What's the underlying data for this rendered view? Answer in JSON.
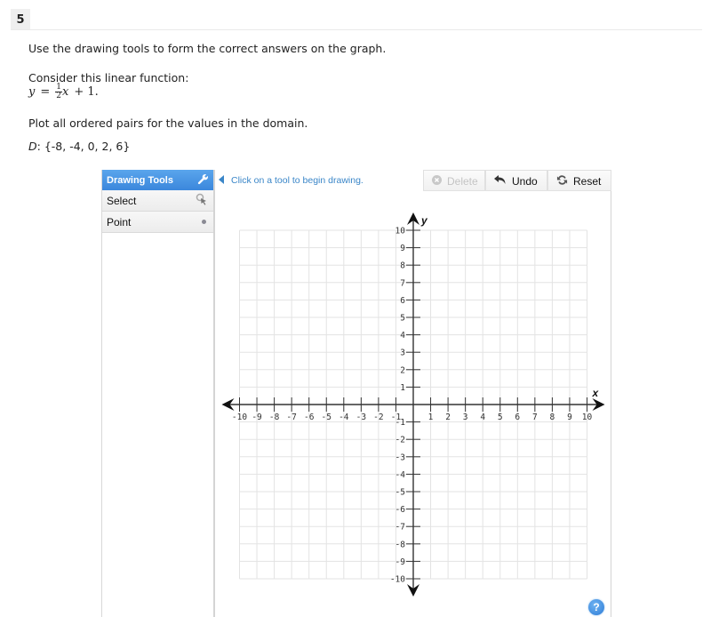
{
  "question": {
    "number": "5",
    "instruction": "Use the drawing tools to form the correct answers on the graph.",
    "consider": "Consider this linear function:",
    "equation": {
      "lhs": "y",
      "equals": "=",
      "frac_num": "1",
      "frac_den": "2",
      "var": "x",
      "rest": "+ 1."
    },
    "plot_prompt": "Plot all ordered pairs for the values in the domain.",
    "domain_label": "D",
    "domain_values": ": {-8, -4, 0, 2, 6}"
  },
  "tools_panel": {
    "title": "Drawing Tools",
    "items": [
      {
        "label": "Select",
        "icon": "select-cursor-icon"
      },
      {
        "label": "Point",
        "icon": "point-dot-icon"
      }
    ]
  },
  "toolbar": {
    "hint": "Click on a tool to begin drawing.",
    "delete_label": "Delete",
    "undo_label": "Undo",
    "reset_label": "Reset"
  },
  "graph": {
    "x_label": "x",
    "y_label": "y",
    "x_range": [
      -10,
      10
    ],
    "y_range": [
      -10,
      10
    ],
    "tick_step": 1,
    "grid": true
  },
  "help_label": "?"
}
